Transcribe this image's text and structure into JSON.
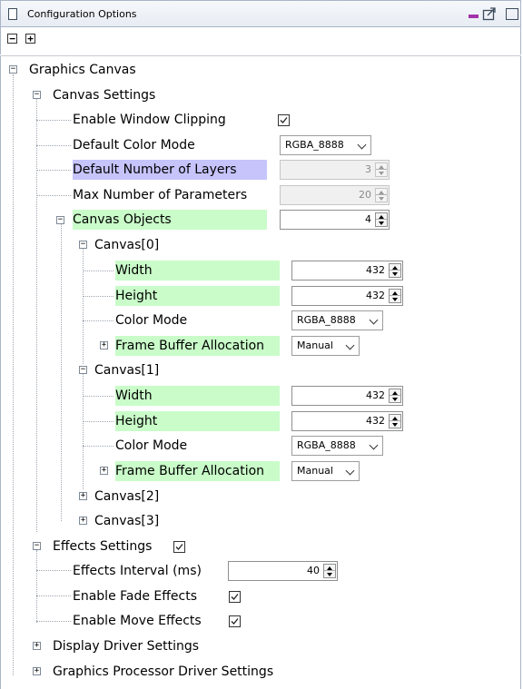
{
  "window": {
    "title": "Configuration Options",
    "collapse_all": "−",
    "expand_all": "+"
  },
  "tree": {
    "graphics_canvas": "Graphics Canvas",
    "canvas_settings": {
      "label": "Canvas Settings",
      "enable_window_clipping": {
        "label": "Enable Window Clipping",
        "checked": true
      },
      "default_color_mode": {
        "label": "Default Color Mode",
        "value": "RGBA_8888"
      },
      "default_number_of_layers": {
        "label": "Default Number of Layers",
        "value": "3"
      },
      "max_number_of_parameters": {
        "label": "Max Number of Parameters",
        "value": "20"
      },
      "canvas_objects": {
        "label": "Canvas Objects",
        "value": "4"
      },
      "canvases": [
        {
          "label": "Canvas[0]",
          "width": {
            "label": "Width",
            "value": "432"
          },
          "height": {
            "label": "Height",
            "value": "432"
          },
          "color_mode": {
            "label": "Color Mode",
            "value": "RGBA_8888"
          },
          "frame_buffer_allocation": {
            "label": "Frame Buffer Allocation",
            "value": "Manual"
          }
        },
        {
          "label": "Canvas[1]",
          "width": {
            "label": "Width",
            "value": "432"
          },
          "height": {
            "label": "Height",
            "value": "432"
          },
          "color_mode": {
            "label": "Color Mode",
            "value": "RGBA_8888"
          },
          "frame_buffer_allocation": {
            "label": "Frame Buffer Allocation",
            "value": "Manual"
          }
        },
        {
          "label": "Canvas[2]"
        },
        {
          "label": "Canvas[3]"
        }
      ]
    },
    "effects_settings": {
      "label": "Effects Settings",
      "checked": true,
      "effects_interval": {
        "label": "Effects Interval (ms)",
        "value": "40"
      },
      "enable_fade_effects": {
        "label": "Enable Fade Effects",
        "checked": true
      },
      "enable_move_effects": {
        "label": "Enable Move Effects",
        "checked": true
      }
    },
    "display_driver_settings": "Display Driver Settings",
    "graphics_processor_driver_settings": "Graphics Processor Driver Settings"
  },
  "colors": {
    "required_highlight": "#c9fcc9",
    "selected_highlight": "#c6c4fb",
    "minimize_accent": "#a233a8"
  },
  "icons": [
    "panel-icon",
    "minimize-icon",
    "popout-icon",
    "maximize-icon",
    "collapse-all-icon",
    "expand-all-icon",
    "tree-expander-icon",
    "checkbox-icon",
    "spinner-icon",
    "dropdown-chevron-icon"
  ]
}
